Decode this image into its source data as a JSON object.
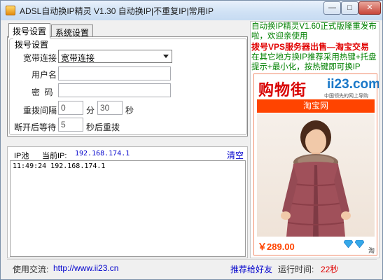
{
  "window": {
    "title": "ADSL自动换IP精灵 V1.30 自动换IP|不重复IP|常用IP",
    "minimize_glyph": "—",
    "maximize_glyph": "□",
    "close_glyph": "✕"
  },
  "tabs": [
    {
      "label": "拨号设置",
      "active": true
    },
    {
      "label": "系统设置",
      "active": false
    }
  ],
  "dial": {
    "group_title": "拨号设置",
    "connection_label": "宽带连接",
    "connection_value": "宽带连接",
    "username_label": "用户名",
    "username_value": "",
    "password_label": "密  码",
    "password_value": "",
    "redial_label": "重拨间隔",
    "redial_minutes": "0",
    "minutes_unit": "分",
    "redial_seconds": "30",
    "seconds_unit": "秒",
    "wait_label": "断开后等待",
    "wait_seconds": "5",
    "wait_suffix": "秒后重拨"
  },
  "ip_pool": {
    "label": "IP池",
    "current_ip_label": "当前IP:",
    "current_ip": "192.168.174.1",
    "clear_label": "清空",
    "log": "11:49:24 192.168.174.1"
  },
  "status": {
    "contact_label": "使用交流:",
    "contact_url": "http://www.ii23.cn",
    "recommend_label": "推荐给好友",
    "runtime_label": "运行时间:",
    "runtime_value": "22秒"
  },
  "ad": {
    "line1": "自动换IP精灵V1.60正式版隆重发布啦，欢迎亲使用",
    "line2": "拨号VPS服务器出售—淘宝交易",
    "line3": "在其它地方换IP推荐采用热键+托盘提示+最小化，按热键即可换IP",
    "shop_logo": "购物街",
    "ii23_logo": "ii23.com",
    "ii23_sub": "中国领先的网上导购",
    "taobao_label": "淘宝网",
    "price": "￥289.00",
    "tao_mark": "淘"
  },
  "colors": {
    "accent_blue": "#0000cc",
    "ad_green": "#008000",
    "ad_red": "#e00000",
    "runtime_red": "#e00000",
    "taobao_orange": "#ff4400"
  }
}
